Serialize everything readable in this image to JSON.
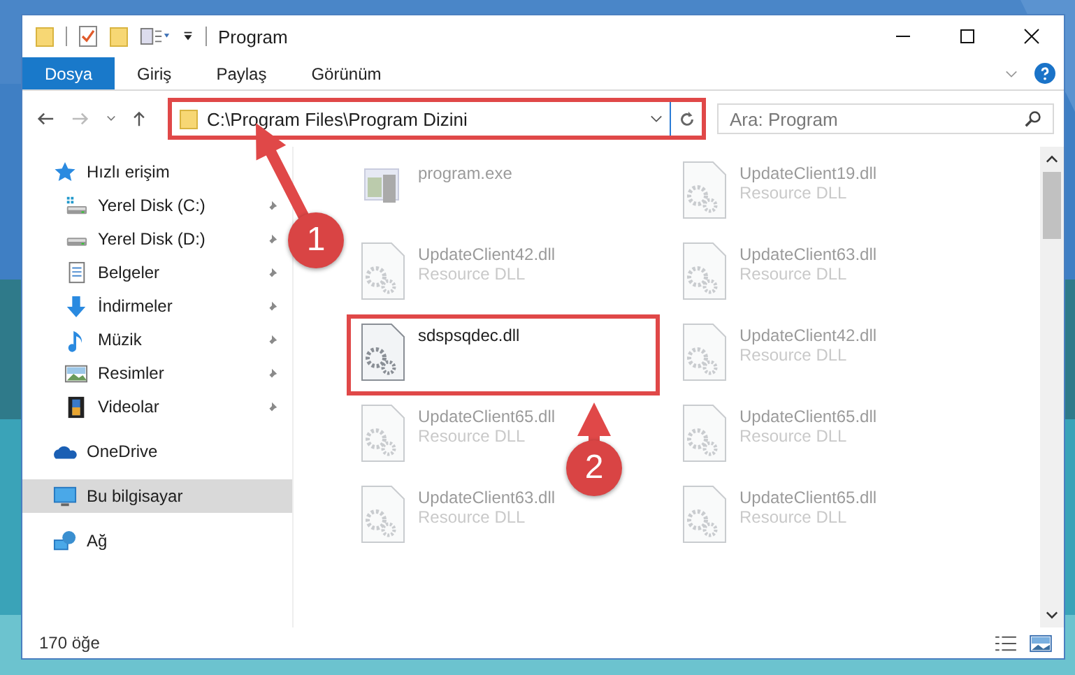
{
  "window": {
    "title": "Program"
  },
  "ribbon_tabs": [
    {
      "label": "Dosya",
      "selected": true
    },
    {
      "label": "Giriş",
      "selected": false
    },
    {
      "label": "Paylaş",
      "selected": false
    },
    {
      "label": "Görünüm",
      "selected": false
    }
  ],
  "address": {
    "path": "C:\\Program Files\\Program Dizini",
    "highlighted": true
  },
  "search": {
    "placeholder": "Ara: Program"
  },
  "sidebar": {
    "items": [
      {
        "label": "Hızlı erişim",
        "kind": "star",
        "selected": false,
        "children": [
          {
            "label": "Yerel Disk (C:)",
            "kind": "system-drive",
            "pinned": true,
            "selected": false
          },
          {
            "label": "Yerel Disk (D:)",
            "kind": "drive",
            "pinned": true,
            "selected": false
          },
          {
            "label": "Belgeler",
            "kind": "document",
            "pinned": true,
            "selected": false
          },
          {
            "label": "İndirmeler",
            "kind": "download",
            "pinned": true,
            "selected": false
          },
          {
            "label": "Müzik",
            "kind": "music",
            "pinned": true,
            "selected": false
          },
          {
            "label": "Resimler",
            "kind": "pictures",
            "pinned": true,
            "selected": false
          },
          {
            "label": "Videolar",
            "kind": "video",
            "pinned": true,
            "selected": false
          }
        ]
      },
      {
        "label": "OneDrive",
        "kind": "cloud",
        "selected": false
      },
      {
        "label": "Bu bilgisayar",
        "kind": "computer",
        "selected": true
      },
      {
        "label": "Ağ",
        "kind": "network",
        "selected": false
      }
    ]
  },
  "files": [
    {
      "name": "program.exe",
      "kind": "exe",
      "blurred": true,
      "highlighted": false
    },
    {
      "name": "UpdateClient19.dll",
      "type": "Resource DLL",
      "kind": "dll",
      "blurred": true,
      "highlighted": false
    },
    {
      "name": "UpdateClient42.dll",
      "type": "Resource DLL",
      "kind": "dll",
      "blurred": true,
      "highlighted": false
    },
    {
      "name": "UpdateClient63.dll",
      "type": "Resource DLL",
      "kind": "dll",
      "blurred": true,
      "highlighted": false
    },
    {
      "name": "sdspsqdec.dll",
      "kind": "dll",
      "blurred": false,
      "highlighted": true
    },
    {
      "name": "UpdateClient42.dll",
      "type": "Resource DLL",
      "kind": "dll",
      "blurred": true,
      "highlighted": false
    },
    {
      "name": "UpdateClient65.dll",
      "type": "Resource DLL",
      "kind": "dll",
      "blurred": true,
      "highlighted": false
    },
    {
      "name": "UpdateClient65.dll",
      "type": "Resource DLL",
      "kind": "dll",
      "blurred": true,
      "highlighted": false
    },
    {
      "name": "UpdateClient63.dll",
      "type": "Resource DLL",
      "kind": "dll",
      "blurred": true,
      "highlighted": false
    },
    {
      "name": "UpdateClient65.dll",
      "type": "Resource DLL",
      "kind": "dll",
      "blurred": true,
      "highlighted": false
    }
  ],
  "callouts": [
    {
      "number": "1"
    },
    {
      "number": "2"
    }
  ],
  "status_bar": {
    "item_count": "170 öğe"
  }
}
